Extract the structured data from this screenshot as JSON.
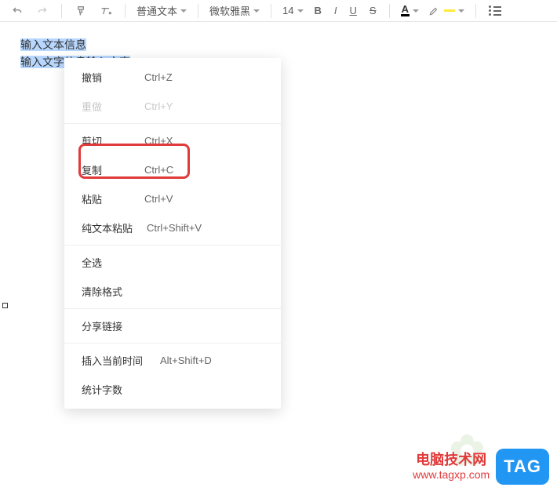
{
  "toolbar": {
    "para_style": "普通文本",
    "font_family": "微软雅黑",
    "font_size": "14",
    "boldGlyph": "B",
    "italicGlyph": "I",
    "underlineGlyph": "U",
    "strikeGlyph": "S",
    "fontColorGlyph": "A"
  },
  "editor": {
    "line1": "输入文本信息",
    "line2_prefix": "输入文字信息输入文字"
  },
  "menu": {
    "undo": {
      "label": "撤销",
      "shortcut": "Ctrl+Z"
    },
    "redo": {
      "label": "重做",
      "shortcut": "Ctrl+Y"
    },
    "cut": {
      "label": "剪切",
      "shortcut": "Ctrl+X"
    },
    "copy": {
      "label": "复制",
      "shortcut": "Ctrl+C"
    },
    "paste": {
      "label": "粘贴",
      "shortcut": "Ctrl+V"
    },
    "pastePlain": {
      "label": "纯文本粘贴",
      "shortcut": "Ctrl+Shift+V"
    },
    "selectAll": {
      "label": "全选"
    },
    "clearFormat": {
      "label": "清除格式"
    },
    "shareLink": {
      "label": "分享链接"
    },
    "insertTime": {
      "label": "插入当前时间",
      "shortcut": "Alt+Shift+D"
    },
    "wordCount": {
      "label": "统计字数"
    }
  },
  "watermark": {
    "title": "电脑技术网",
    "url": "www.tagxp.com",
    "badge": "TAG"
  }
}
